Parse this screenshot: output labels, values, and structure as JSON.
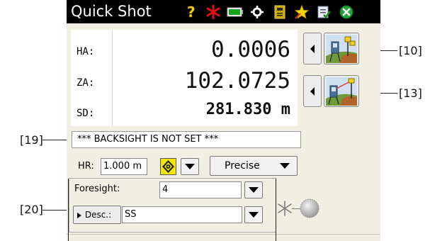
{
  "titlebar": {
    "title": "Quick Shot",
    "icons": [
      "help-icon",
      "laser-pointer-icon",
      "battery-icon",
      "settings-gear-icon",
      "data-card-icon",
      "favorites-star-icon",
      "checklist-icon",
      "close-icon"
    ]
  },
  "readout": {
    "rows": [
      {
        "label": "HA:",
        "value": "0.0006"
      },
      {
        "label": "ZA:",
        "value": "102.0725"
      },
      {
        "label": "SD:",
        "value": "281.830 m"
      }
    ]
  },
  "status_message": "*** BACKSIGHT IS NOT SET ***",
  "hr": {
    "label": "HR:",
    "value": "1.000 m"
  },
  "mode": {
    "selected": "Precise"
  },
  "foresight": {
    "label": "Foresight:",
    "value": "4"
  },
  "description": {
    "button_label": "Desc.:",
    "value": "SS"
  },
  "callouts": {
    "c10": "[10]",
    "c13": "[13]",
    "c19": "[19]",
    "c20": "[20]"
  }
}
